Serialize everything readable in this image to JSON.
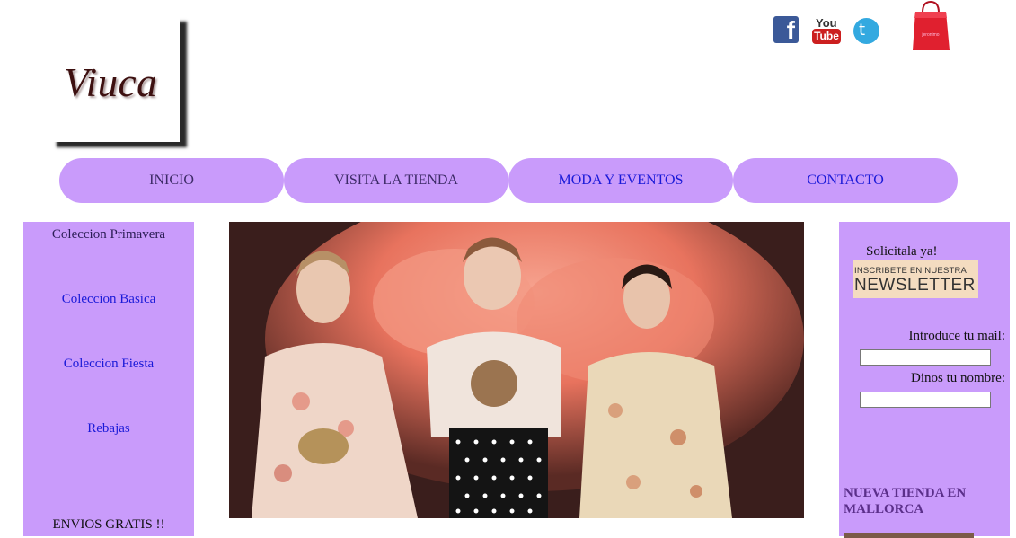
{
  "logo": {
    "text": "Viuca"
  },
  "social": {
    "facebook_glyph": "f",
    "youtube_top": "You",
    "youtube_bottom": "Tube",
    "twitter_glyph": "t",
    "bag_label": "jeronimo"
  },
  "nav": {
    "items": [
      {
        "label": "INICIO"
      },
      {
        "label": "VISITA LA TIENDA"
      },
      {
        "label": "MODA Y EVENTOS"
      },
      {
        "label": "CONTACTO"
      }
    ]
  },
  "sidebar": {
    "items": [
      {
        "label": "Coleccion Primavera"
      },
      {
        "label": "Coleccion Basica"
      },
      {
        "label": "Coleccion Fiesta"
      },
      {
        "label": "Rebajas"
      }
    ],
    "footer": "ENVIOS GRATIS !!"
  },
  "newsletter": {
    "cta": "Solicitala ya!",
    "badge_line1": "INSCRIBETE EN NUESTRA",
    "badge_line2": "NEWSLETTER",
    "mail_label": "Introduce tu mail:",
    "name_label": "Dinos tu nombre:",
    "mail_value": "",
    "name_value": ""
  },
  "promo": {
    "heading": "NUEVA TIENDA EN MALLORCA"
  },
  "colors": {
    "accent": "#c99bfb",
    "link": "#1a1ad8",
    "heading": "#5b2f8a"
  }
}
